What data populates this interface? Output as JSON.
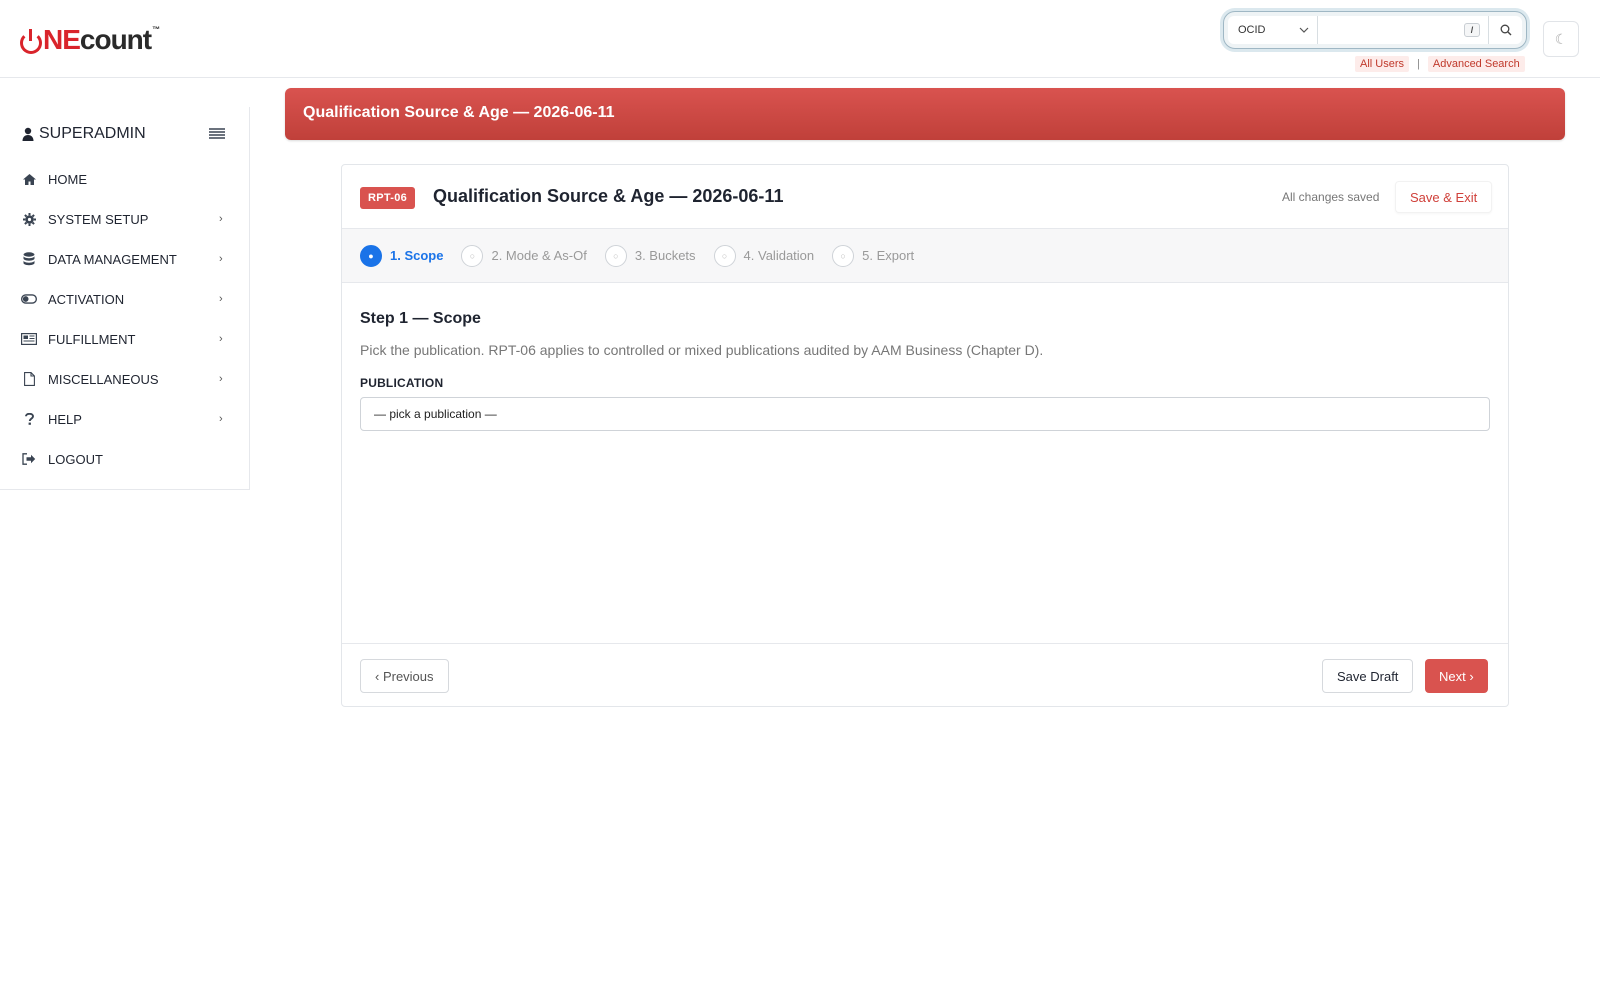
{
  "header": {
    "logo": "ONEcount",
    "search": {
      "type_selected": "OCID",
      "query_value": "",
      "shortcut_key": "/"
    },
    "quick_links": {
      "all_users": "All Users",
      "separator": "|",
      "advanced_search": "Advanced Search"
    },
    "theme_toggle_icon": "☾"
  },
  "sidebar": {
    "user": "SUPERADMIN",
    "items": [
      {
        "label": "HOME",
        "icon": "home-icon",
        "has_submenu": false
      },
      {
        "label": "SYSTEM SETUP",
        "icon": "gear-icon",
        "has_submenu": true
      },
      {
        "label": "DATA MANAGEMENT",
        "icon": "database-icon",
        "has_submenu": true
      },
      {
        "label": "ACTIVATION",
        "icon": "toggle-icon",
        "has_submenu": true
      },
      {
        "label": "FULFILLMENT",
        "icon": "newspaper-icon",
        "has_submenu": true
      },
      {
        "label": "MISCELLANEOUS",
        "icon": "file-icon",
        "has_submenu": true
      },
      {
        "label": "HELP",
        "icon": "question-icon",
        "has_submenu": true
      },
      {
        "label": "LOGOUT",
        "icon": "logout-icon",
        "has_submenu": false
      }
    ],
    "chevron": "›"
  },
  "banner": {
    "title": "Qualification Source & Age — 2026-06-11"
  },
  "wizard": {
    "badge": "RPT-06",
    "title": "Qualification Source & Age — 2026-06-11",
    "saved_status": "All changes saved",
    "save_exit_label": "Save & Exit",
    "steps": [
      {
        "label": "1. Scope",
        "marker": "●",
        "active": true
      },
      {
        "label": "2. Mode & As-Of",
        "marker": "○",
        "active": false
      },
      {
        "label": "3. Buckets",
        "marker": "○",
        "active": false
      },
      {
        "label": "4. Validation",
        "marker": "○",
        "active": false
      },
      {
        "label": "5. Export",
        "marker": "○",
        "active": false
      }
    ],
    "step_title": "Step 1 — Scope",
    "step_description": "Pick the publication. RPT-06 applies to controlled or mixed publications audited by AAM Business (Chapter D).",
    "publication_label": "PUBLICATION",
    "publication_value": "— pick a publication —",
    "previous_label": "‹ Previous",
    "save_draft_label": "Save Draft",
    "next_label": "Next ›"
  },
  "colors": {
    "accent_red": "#d9534f",
    "active_step_blue": "#1a73e8"
  }
}
